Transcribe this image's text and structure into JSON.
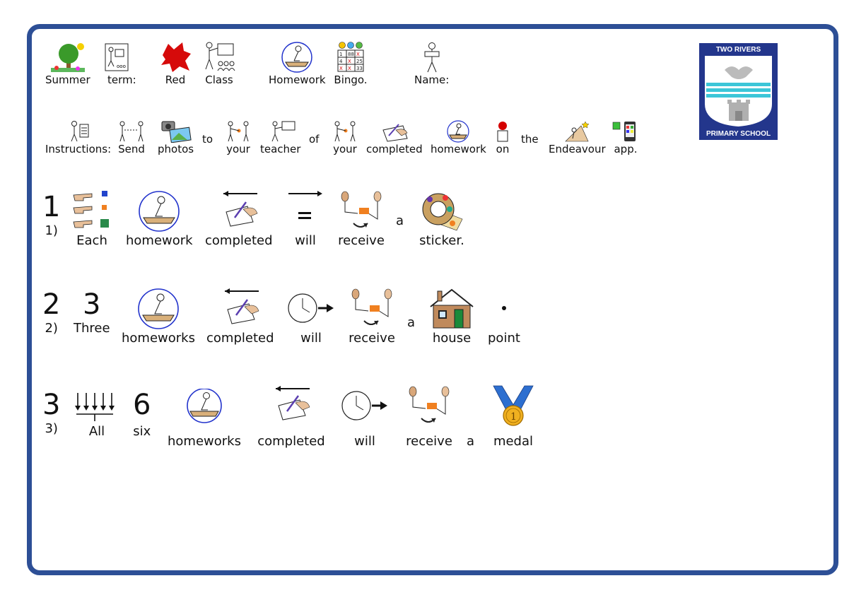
{
  "header": {
    "summer": "Summer",
    "term": "term:",
    "red": "Red",
    "class": "Class",
    "homework": "Homework",
    "bingo": "Bingo.",
    "name": "Name:"
  },
  "instructions": {
    "instructions": "Instructions:",
    "send": "Send",
    "photos": "photos",
    "to": "to",
    "your1": "your",
    "teacher": "teacher",
    "of": "of",
    "your2": "your",
    "completed": "completed",
    "homework": "homework",
    "on": "on",
    "the": "the",
    "endeavour": "Endeavour",
    "app": "app."
  },
  "rule1": {
    "num_glyph": "1",
    "num": "1)",
    "each": "Each",
    "homework": "homework",
    "completed": "completed",
    "will": "will",
    "receive": "receive",
    "a": "a",
    "sticker": "sticker."
  },
  "rule2": {
    "num_glyph": "2",
    "three_glyph": "3",
    "num": "2)",
    "three": "Three",
    "homeworks": "homeworks",
    "completed": "completed",
    "will": "will",
    "receive": "receive",
    "a": "a",
    "house": "house",
    "point": "point"
  },
  "rule3": {
    "num_glyph": "3",
    "six_glyph": "6",
    "num": "3)",
    "all": "All",
    "six": "six",
    "homeworks": "homeworks",
    "completed": "completed",
    "will": "will",
    "receive": "receive",
    "a": "a",
    "medal": "medal"
  },
  "logo": {
    "top_text": "TWO RIVERS",
    "bottom_text": "PRIMARY SCHOOL"
  },
  "bingo_grid": [
    "1",
    "88",
    "X",
    "4",
    "X",
    "25",
    "X",
    "X",
    "33"
  ],
  "colors": {
    "border": "#2d4f96",
    "logo_bg": "#23368c",
    "circle": "#2233cc",
    "orange": "#f08020"
  }
}
